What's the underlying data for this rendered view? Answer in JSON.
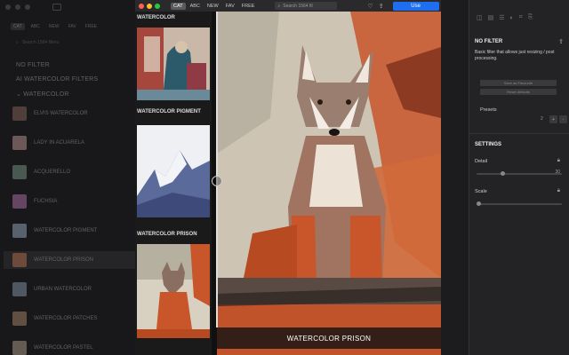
{
  "left_panel": {
    "tabs": [
      "CAT",
      "ABC",
      "NEW",
      "FAV",
      "FREE"
    ],
    "search_placeholder": "Search 1564 filters",
    "header_no_filter": "NO FILTER",
    "header_ai": "AI WATERCOLOR FILTERS",
    "header_watercolor": "WATERCOLOR",
    "items": [
      {
        "label": "ELVIS WATERCOLOR",
        "color": "#7a5a50"
      },
      {
        "label": "LADY IN ACUARELA",
        "color": "#b08a88"
      },
      {
        "label": "ACQUERELLO",
        "color": "#6e8a7a"
      },
      {
        "label": "FUCHSIA",
        "color": "#a06a9a"
      },
      {
        "label": "WATERCOLOR PIGMENT",
        "color": "#8a9ab0"
      },
      {
        "label": "WATERCOLOR PRISON",
        "color": "#b07050"
      },
      {
        "label": "URBAN WATERCOLOR",
        "color": "#7a8a9a"
      },
      {
        "label": "WATERCOLOR PATCHES",
        "color": "#9a7a60"
      },
      {
        "label": "WATERCOLOR PASTEL",
        "color": "#a09080"
      }
    ]
  },
  "window": {
    "tabs": [
      "CAT",
      "ABC",
      "NEW",
      "FAV",
      "FREE"
    ],
    "search_placeholder": "Search 1564 fil",
    "use_label": "Use"
  },
  "thumbnails": [
    {
      "title": "WATERCOLOR"
    },
    {
      "title": "WATERCOLOR PIGMENT"
    },
    {
      "title": "WATERCOLOR PRISON"
    }
  ],
  "preview": {
    "caption": "WATERCOLOR PRISON"
  },
  "right_panel": {
    "title": "NO FILTER",
    "description": "Basic filter that allows just resizing / post processing.",
    "btn_save": "Save as Favourite",
    "btn_reset": "Reset defaults",
    "presets_label": "Presets",
    "presets_value": "2",
    "plus": "+",
    "minus": "-",
    "settings_label": "SETTINGS",
    "detail_label": "Detail",
    "detail_value": "30",
    "detail_fraction": 0.3,
    "scale_label": "Scale",
    "scale_value": "",
    "scale_fraction": 0.0
  },
  "colors": {
    "accent": "#1e6ff0",
    "fox_orange": "#c8562a"
  }
}
